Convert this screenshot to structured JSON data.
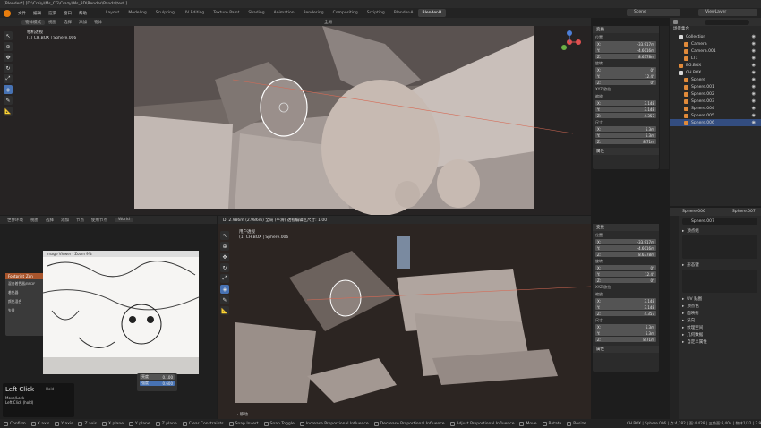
{
  "title": "[Blender*] [D:\\Cra\\y\\Ms_CG\\Crazy\\Ms_3D\\Render\\Panda\\test.]",
  "menu": [
    "文件",
    "编辑",
    "渲染",
    "窗口",
    "帮助"
  ],
  "workspaces": [
    "Layout",
    "Modeling",
    "Sculpting",
    "UV Editing",
    "Texture Paint",
    "Shading",
    "Animation",
    "Rendering",
    "Compositing",
    "Scripting",
    "Blender-A",
    "Blender-B"
  ],
  "active_workspace": "Blender-B",
  "scene": {
    "name": "Scene",
    "view_layer": "ViewLayer"
  },
  "top_header": {
    "mode": "物体模式",
    "items": [
      "视图",
      "选择",
      "添加",
      "物体"
    ],
    "shading": "全局"
  },
  "top_viewport": {
    "label1": "相机透视",
    "label2": "(1) CH.BOX | Sphere.006"
  },
  "bottom_viewport": {
    "label1": "用户透视",
    "label2": "(1) CH.BOX | Sphere.006",
    "header_text": "D: 2.986m (2.986m) 全局 (平滑)   透视编辑区尺寸: 1.00"
  },
  "n_panel": {
    "header": "变换",
    "location_label": "位置:",
    "rotation_label": "旋转:",
    "mode_label": "XYZ 欧拉",
    "scale_label": "缩放:",
    "dims_label": "尺寸:",
    "footer": "属性",
    "loc": [
      [
        "X:",
        "-33.917m"
      ],
      [
        "Y:",
        "-4.6016m"
      ],
      [
        "Z:",
        "8.6378m"
      ]
    ],
    "rot": [
      [
        "X:",
        "0°"
      ],
      [
        "Y:",
        "12.4°"
      ],
      [
        "Z:",
        "0°"
      ]
    ],
    "scale": [
      [
        "X:",
        "3.148"
      ],
      [
        "Y:",
        "3.148"
      ],
      [
        "Z:",
        "4.357"
      ]
    ],
    "dims": [
      [
        "X:",
        "6.3m"
      ],
      [
        "Y:",
        "6.3m"
      ],
      [
        "Z:",
        "8.71m"
      ]
    ]
  },
  "outliner": {
    "title": "场景集合",
    "rows": [
      {
        "label": "Collection",
        "icon": "collection-icon",
        "color": "#d8d8d8",
        "indent": 1
      },
      {
        "label": "Camera",
        "icon": "camera-icon",
        "color": "#e08a3a",
        "indent": 2
      },
      {
        "label": "Camera.001",
        "icon": "camera-icon",
        "color": "#e08a3a",
        "indent": 2
      },
      {
        "label": "LT1",
        "icon": "light-icon",
        "color": "#e08a3a",
        "indent": 2
      },
      {
        "label": "BG.BOX",
        "icon": "mesh-icon",
        "color": "#e08a3a",
        "indent": 1
      },
      {
        "label": "CH.BOX",
        "icon": "collection-icon",
        "color": "#d8d8d8",
        "indent": 1
      },
      {
        "label": "Sphere",
        "icon": "mesh-icon",
        "color": "#e08a3a",
        "indent": 2
      },
      {
        "label": "Sphere.001",
        "icon": "mesh-icon",
        "color": "#e08a3a",
        "indent": 2
      },
      {
        "label": "Sphere.002",
        "icon": "mesh-icon",
        "color": "#e08a3a",
        "indent": 2
      },
      {
        "label": "Sphere.003",
        "icon": "mesh-icon",
        "color": "#e08a3a",
        "indent": 2
      },
      {
        "label": "Sphere.004",
        "icon": "mesh-icon",
        "color": "#e08a3a",
        "indent": 2
      },
      {
        "label": "Sphere.005",
        "icon": "mesh-icon",
        "color": "#e08a3a",
        "indent": 2
      },
      {
        "label": "Sphere.006",
        "icon": "mesh-icon",
        "color": "#e08a3a",
        "indent": 2,
        "selected": true
      }
    ]
  },
  "properties": {
    "object": "Sphere.006",
    "object2": "Sphere.007",
    "field": "Sphere.007",
    "sections": [
      "顶点组",
      "形态键",
      "UV 贴图",
      "顶点色",
      "面映射",
      "法向",
      "纹理空间",
      "几何数据",
      "自定义属性"
    ]
  },
  "node_editor": {
    "header": [
      "世界环境",
      "视图",
      "选择",
      "添加",
      "节点",
      "使用节点"
    ],
    "world": "World",
    "node_title": "Footprint_Zon",
    "node_rows": [
      "混合着色器/BSDF",
      "着色器",
      "颜色混合",
      "矢量"
    ],
    "popup": [
      "亮度",
      "0.100",
      "强度",
      "0.600"
    ]
  },
  "image_viewer": {
    "title": "Image Viewer - Zoom 9%"
  },
  "last_op": {
    "title": "Left Click",
    "sub1": "Move/Lock",
    "sub2": "Left Click (hold)",
    "badge": "Hold"
  },
  "bottom_hint": "· 移动",
  "statusbar": {
    "left": [
      "Confirm",
      "X axis",
      "Y axis",
      "Z axis",
      "X plane",
      "Y plane",
      "Z plane",
      "Clear Constraints",
      "Snap Invert",
      "Snap Toggle",
      "Increase Proportional Influence",
      "Decrease Proportional Influence",
      "Adjust Proportional Influence",
      "Move",
      "Rotate",
      "Resize"
    ],
    "right": "CH.BOX | Sphere.006 | 点:4,282 | 面:4,428 | 三角面:8,404 | 物体1/32 | 2.90"
  }
}
